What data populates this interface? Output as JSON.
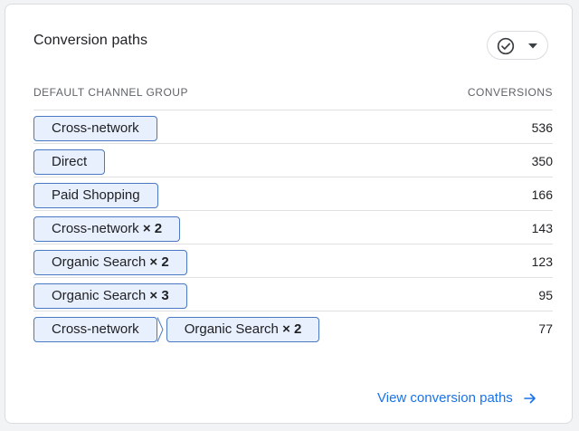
{
  "card": {
    "title": "Conversion paths"
  },
  "icons": {
    "filter": "check-circle-icon",
    "dropdown": "caret-down-icon",
    "link_arrow": "arrow-right-icon"
  },
  "table": {
    "col_left": "DEFAULT CHANNEL GROUP",
    "col_right": "CONVERSIONS",
    "rows": [
      {
        "steps": [
          {
            "label": "Cross-network",
            "mult": ""
          }
        ],
        "value": "536"
      },
      {
        "steps": [
          {
            "label": "Direct",
            "mult": ""
          }
        ],
        "value": "350"
      },
      {
        "steps": [
          {
            "label": "Paid Shopping",
            "mult": ""
          }
        ],
        "value": "166"
      },
      {
        "steps": [
          {
            "label": "Cross-network",
            "mult": "× 2"
          }
        ],
        "value": "143"
      },
      {
        "steps": [
          {
            "label": "Organic Search",
            "mult": "× 2"
          }
        ],
        "value": "123"
      },
      {
        "steps": [
          {
            "label": "Organic Search",
            "mult": "× 3"
          }
        ],
        "value": "95"
      },
      {
        "steps": [
          {
            "label": "Cross-network",
            "mult": ""
          },
          {
            "label": "Organic Search",
            "mult": "× 2"
          }
        ],
        "value": "77"
      }
    ]
  },
  "footer": {
    "link_label": "View conversion paths"
  },
  "colors": {
    "chip_border": "#4a78c2",
    "chip_bg": "#e8f0fe",
    "link": "#1a73e8"
  }
}
